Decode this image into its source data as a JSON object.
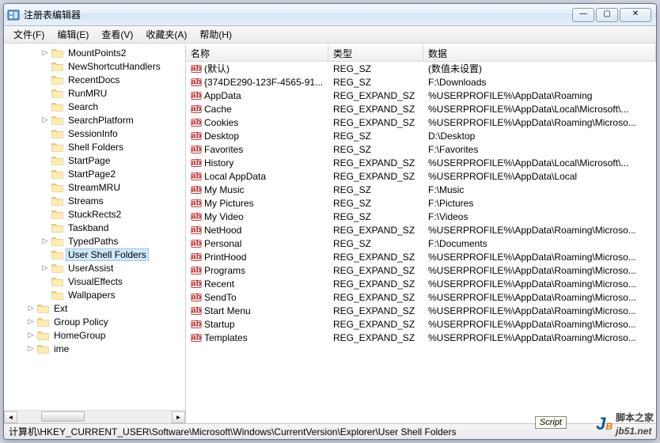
{
  "window": {
    "title": "注册表编辑器"
  },
  "winbuttons": {
    "min": "—",
    "max": "▢",
    "close": "✕"
  },
  "menu": [
    {
      "label": "文件(F)"
    },
    {
      "label": "编辑(E)"
    },
    {
      "label": "查看(V)"
    },
    {
      "label": "收藏夹(A)"
    },
    {
      "label": "帮助(H)"
    }
  ],
  "columns": {
    "name": "名称",
    "type": "类型",
    "data": "数据"
  },
  "tree": [
    {
      "indent": 2,
      "exp": true,
      "label": "MountPoints2"
    },
    {
      "indent": 2,
      "exp": false,
      "label": "NewShortcutHandlers"
    },
    {
      "indent": 2,
      "exp": false,
      "label": "RecentDocs"
    },
    {
      "indent": 2,
      "exp": false,
      "label": "RunMRU"
    },
    {
      "indent": 2,
      "exp": false,
      "label": "Search"
    },
    {
      "indent": 2,
      "exp": true,
      "label": "SearchPlatform"
    },
    {
      "indent": 2,
      "exp": false,
      "label": "SessionInfo"
    },
    {
      "indent": 2,
      "exp": false,
      "label": "Shell Folders"
    },
    {
      "indent": 2,
      "exp": false,
      "label": "StartPage"
    },
    {
      "indent": 2,
      "exp": false,
      "label": "StartPage2"
    },
    {
      "indent": 2,
      "exp": false,
      "label": "StreamMRU"
    },
    {
      "indent": 2,
      "exp": false,
      "label": "Streams"
    },
    {
      "indent": 2,
      "exp": false,
      "label": "StuckRects2"
    },
    {
      "indent": 2,
      "exp": false,
      "label": "Taskband"
    },
    {
      "indent": 2,
      "exp": true,
      "label": "TypedPaths"
    },
    {
      "indent": 2,
      "exp": false,
      "label": "User Shell Folders",
      "selected": true
    },
    {
      "indent": 2,
      "exp": true,
      "label": "UserAssist"
    },
    {
      "indent": 2,
      "exp": false,
      "label": "VisualEffects"
    },
    {
      "indent": 2,
      "exp": false,
      "label": "Wallpapers"
    },
    {
      "indent": 1,
      "exp": true,
      "label": "Ext"
    },
    {
      "indent": 1,
      "exp": true,
      "label": "Group Policy"
    },
    {
      "indent": 1,
      "exp": true,
      "label": "HomeGroup"
    },
    {
      "indent": 1,
      "exp": true,
      "label": "ime"
    }
  ],
  "values": [
    {
      "name": "(默认)",
      "type": "REG_SZ",
      "data": "(数值未设置)"
    },
    {
      "name": "{374DE290-123F-4565-91...",
      "type": "REG_SZ",
      "data": "F:\\Downloads"
    },
    {
      "name": "AppData",
      "type": "REG_EXPAND_SZ",
      "data": "%USERPROFILE%\\AppData\\Roaming"
    },
    {
      "name": "Cache",
      "type": "REG_EXPAND_SZ",
      "data": "%USERPROFILE%\\AppData\\Local\\Microsoft\\..."
    },
    {
      "name": "Cookies",
      "type": "REG_EXPAND_SZ",
      "data": "%USERPROFILE%\\AppData\\Roaming\\Microso..."
    },
    {
      "name": "Desktop",
      "type": "REG_SZ",
      "data": "D:\\Desktop"
    },
    {
      "name": "Favorites",
      "type": "REG_SZ",
      "data": "F:\\Favorites"
    },
    {
      "name": "History",
      "type": "REG_EXPAND_SZ",
      "data": "%USERPROFILE%\\AppData\\Local\\Microsoft\\..."
    },
    {
      "name": "Local AppData",
      "type": "REG_EXPAND_SZ",
      "data": "%USERPROFILE%\\AppData\\Local"
    },
    {
      "name": "My Music",
      "type": "REG_SZ",
      "data": "F:\\Music"
    },
    {
      "name": "My Pictures",
      "type": "REG_SZ",
      "data": "F:\\Pictures"
    },
    {
      "name": "My Video",
      "type": "REG_SZ",
      "data": "F:\\Videos"
    },
    {
      "name": "NetHood",
      "type": "REG_EXPAND_SZ",
      "data": "%USERPROFILE%\\AppData\\Roaming\\Microso..."
    },
    {
      "name": "Personal",
      "type": "REG_SZ",
      "data": "F:\\Documents"
    },
    {
      "name": "PrintHood",
      "type": "REG_EXPAND_SZ",
      "data": "%USERPROFILE%\\AppData\\Roaming\\Microso..."
    },
    {
      "name": "Programs",
      "type": "REG_EXPAND_SZ",
      "data": "%USERPROFILE%\\AppData\\Roaming\\Microso..."
    },
    {
      "name": "Recent",
      "type": "REG_EXPAND_SZ",
      "data": "%USERPROFILE%\\AppData\\Roaming\\Microso..."
    },
    {
      "name": "SendTo",
      "type": "REG_EXPAND_SZ",
      "data": "%USERPROFILE%\\AppData\\Roaming\\Microso..."
    },
    {
      "name": "Start Menu",
      "type": "REG_EXPAND_SZ",
      "data": "%USERPROFILE%\\AppData\\Roaming\\Microso..."
    },
    {
      "name": "Startup",
      "type": "REG_EXPAND_SZ",
      "data": "%USERPROFILE%\\AppData\\Roaming\\Microso..."
    },
    {
      "name": "Templates",
      "type": "REG_EXPAND_SZ",
      "data": "%USERPROFILE%\\AppData\\Roaming\\Microso..."
    }
  ],
  "status": "计算机\\HKEY_CURRENT_USER\\Software\\Microsoft\\Windows\\CurrentVersion\\Explorer\\User Shell Folders",
  "watermark": {
    "badge": "Script",
    "site": "脚本之家",
    "url": "jb51.net"
  }
}
